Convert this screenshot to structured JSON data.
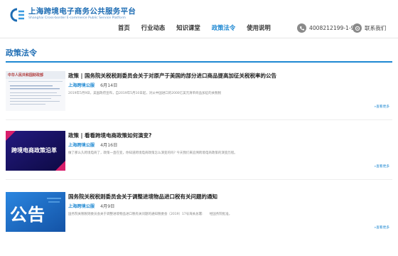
{
  "site": {
    "name_cn": "上海跨境电子商务公共服务平台",
    "name_en": "Shanghai Cross-border E-commerce Public Service Platform"
  },
  "nav": {
    "items": [
      {
        "label": "首页"
      },
      {
        "label": "行业动态"
      },
      {
        "label": "知识课堂"
      },
      {
        "label": "政策法令"
      },
      {
        "label": "使用说明"
      }
    ]
  },
  "header": {
    "phone": "4008212199-1-9",
    "contact_label": "联系我们"
  },
  "section": {
    "title": "政策法令"
  },
  "articles": [
    {
      "title": "政策 | 国务院关税税则委员会关于对原产于美国的部分进口商品提高加征关税税率的公告",
      "source": "上海跨境公服",
      "date": "6月14日",
      "summary": "2019年5月9日，美国政府宣布，自2019年5月10日起，对从中国进口的2000亿美元清单商品加征的关税税",
      "more": "»查看更多",
      "thumb_label": "中华人民共和国财政部"
    },
    {
      "title": "政策 | 看看跨境电商政策如何演变?",
      "source": "上海跨境公服",
      "date": "4月16日",
      "summary": "做了那么久跨境电商了，政策一直在变，你知道跨境电商政策怎么演变的吗? 今天我们来追溯跨境电商政策的演变历程。",
      "more": "»查看更多",
      "thumb_label": "跨境电商政策沿革"
    },
    {
      "title": "国务院关税税则委员会关于调整进境物品进口税有关问题的通知",
      "source": "上海跨境公服",
      "date": "4月9日",
      "summary": "国务院关税税则委员会关于调整进境物品进口税有关问题的通知税委会〔2019〕17号海关总署:　　经国务院批准，",
      "more": "»查看更多",
      "thumb_label": "公告"
    }
  ],
  "colors": {
    "accent": "#1e88d2",
    "brand": "#1e6db4"
  }
}
